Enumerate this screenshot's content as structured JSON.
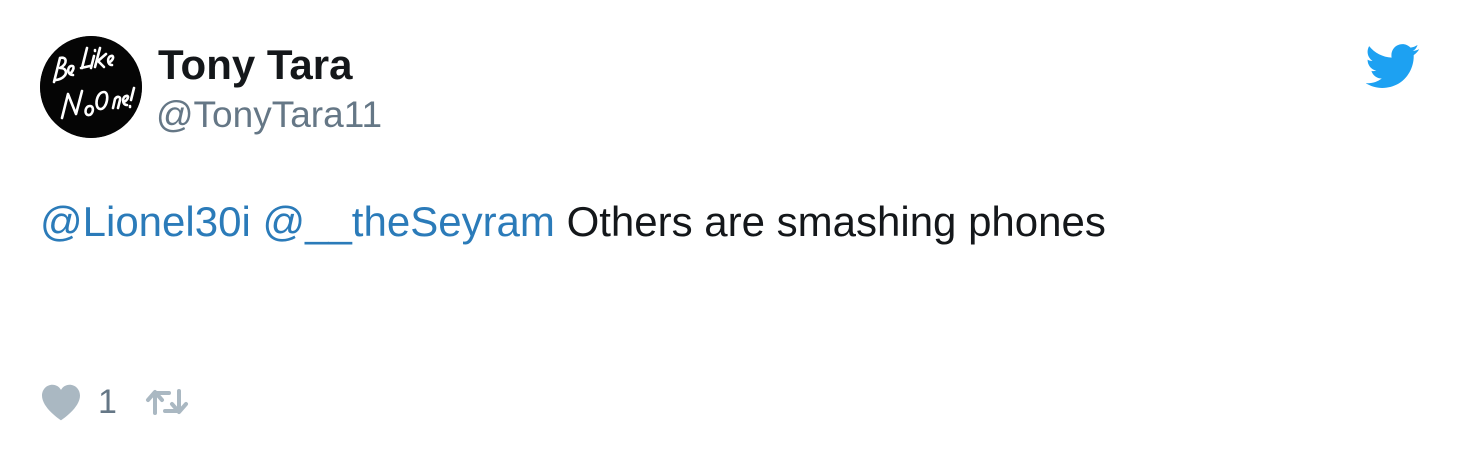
{
  "user": {
    "display_name": "Tony Tara",
    "screen_name": "@TonyTara11",
    "avatar_text": "Be Like No One!"
  },
  "tweet": {
    "mentions": [
      "@Lionel30i",
      "@__theSeyram"
    ],
    "text": " Others are smashing phones"
  },
  "actions": {
    "like_count": "1"
  },
  "icons": {
    "brand": "twitter-bird-icon",
    "like": "heart-icon",
    "retweet": "retweet-icon"
  },
  "colors": {
    "link": "#2b7bb9",
    "twitter_blue": "#1da1f2",
    "muted": "#657786",
    "action_icon": "#aab8c2",
    "text": "#14171a"
  }
}
